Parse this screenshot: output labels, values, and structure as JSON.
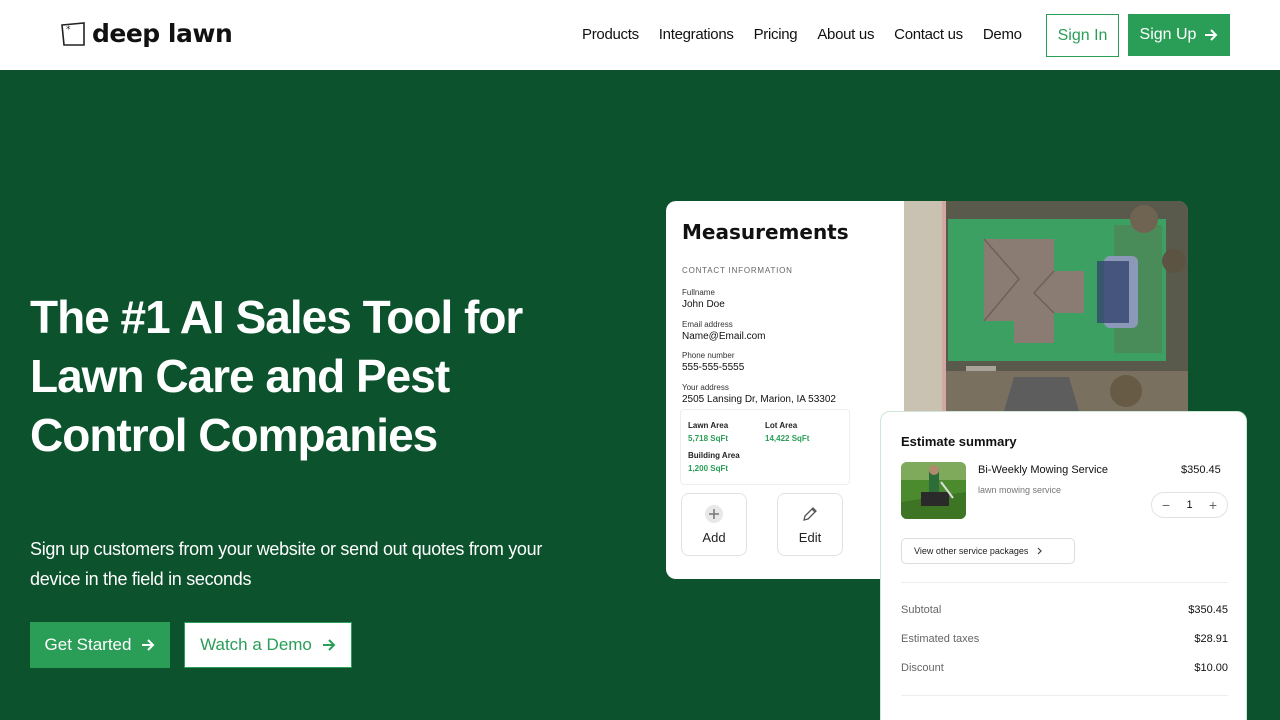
{
  "brand": {
    "name": "deep lawn"
  },
  "nav": {
    "links": [
      "Products",
      "Integrations",
      "Pricing",
      "About us",
      "Contact us",
      "Demo"
    ],
    "sign_in": "Sign In",
    "sign_up": "Sign Up"
  },
  "hero": {
    "title": "The #1 AI Sales Tool for Lawn Care and Pest Control Companies",
    "subtitle": "Sign up customers from your website or send out quotes from your device in the field in seconds",
    "cta_primary": "Get Started",
    "cta_secondary": "Watch a Demo"
  },
  "measurements": {
    "title": "Measurements",
    "section_label": "CONTACT INFORMATION",
    "fields": [
      {
        "label": "Fullname",
        "value": "John Doe"
      },
      {
        "label": "Email address",
        "value": "Name@Email.com"
      },
      {
        "label": "Phone number",
        "value": "555-555-5555"
      },
      {
        "label": "Your address",
        "value": "2505 Lansing Dr, Marion, IA 53302"
      }
    ],
    "areas": [
      {
        "label": "Lawn Area",
        "value": "5,718 SqFt"
      },
      {
        "label": "Lot Area",
        "value": "14,422 SqFt"
      },
      {
        "label": "Building Area",
        "value": "1,200 SqFt"
      }
    ],
    "actions": {
      "add": "Add",
      "edit": "Edit"
    }
  },
  "estimate": {
    "title": "Estimate summary",
    "service": {
      "name": "Bi-Weekly Mowing Service",
      "description": "lawn mowing service",
      "price": "$350.45",
      "quantity": "1"
    },
    "view_packages": "View other service packages",
    "summary": [
      {
        "label": "Subtotal",
        "value": "$350.45"
      },
      {
        "label": "Estimated taxes",
        "value": "$28.91"
      },
      {
        "label": "Discount",
        "value": "$10.00"
      }
    ]
  },
  "colors": {
    "hero_bg": "#0b522d",
    "accent": "#2a9d57",
    "nav_bg": "#ffffff"
  },
  "icons": [
    "logo-mark-icon",
    "arrow-right-icon",
    "plus-icon",
    "pencil-icon",
    "minus-icon",
    "chevron-right-icon"
  ]
}
